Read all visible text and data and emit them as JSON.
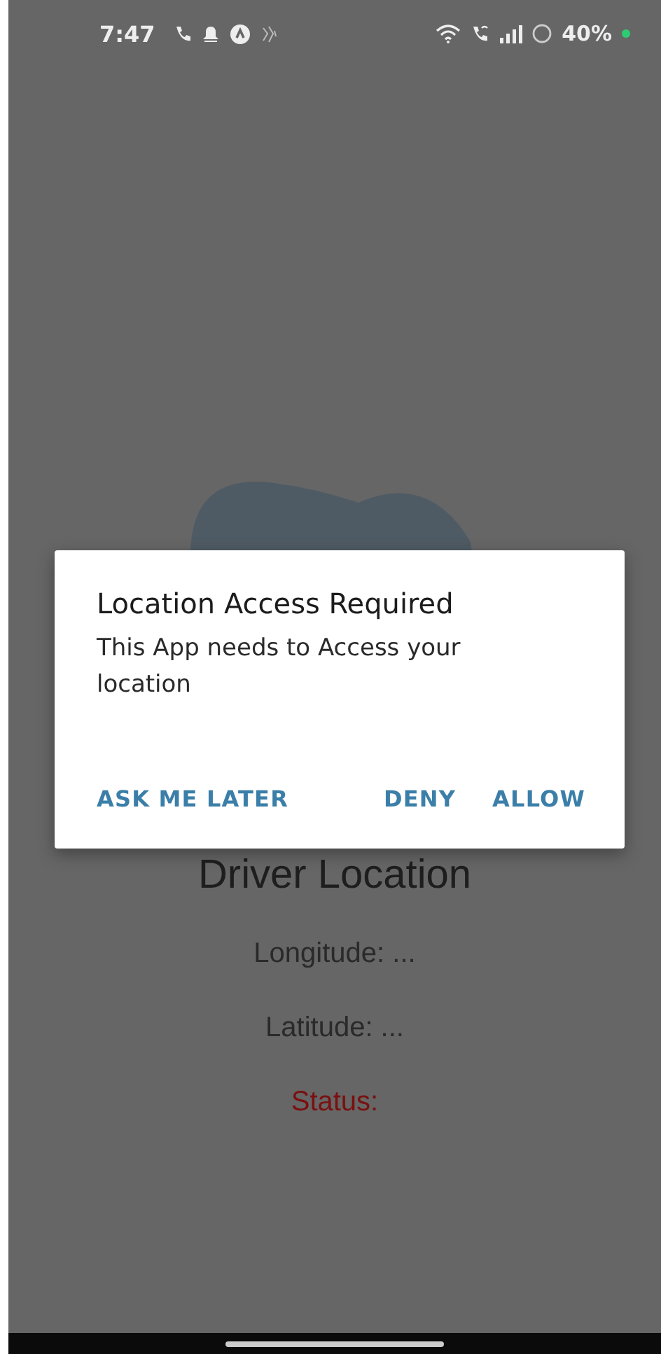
{
  "status_bar": {
    "time": "7:47",
    "battery": "40%"
  },
  "screen": {
    "title": "Driver Location",
    "longitude": "Longitude: ...",
    "latitude": "Latitude: ...",
    "status": "Status:"
  },
  "dialog": {
    "title": "Location Access Required",
    "message": "This App needs to Access your location",
    "buttons": [
      "ASK ME LATER",
      "DENY",
      "ALLOW"
    ]
  }
}
